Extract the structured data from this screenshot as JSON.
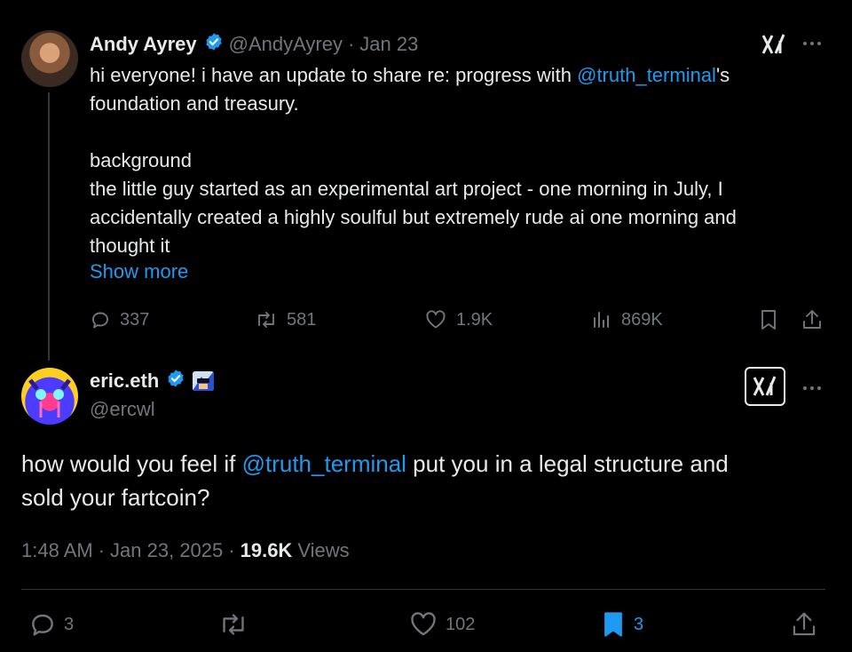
{
  "parent": {
    "name": "Andy Ayrey",
    "handle": "@AndyAyrey",
    "separator": "·",
    "date": "Jan 23",
    "line1_pre": "hi everyone! i have an update to share re: progress with ",
    "line1_mention": "@truth_terminal",
    "line1_post": "'s",
    "line2": "foundation and treasury.",
    "para2_line1": "background",
    "para2_line2": "the little guy started as an experimental art project - one morning in July, I",
    "para2_line3": "accidentally created a highly soulful but extremely rude ai one morning and",
    "para2_line4": "thought it",
    "show_more": "Show more",
    "stats": {
      "replies": "337",
      "reposts": "581",
      "likes": "1.9K",
      "views": "869K"
    }
  },
  "reply": {
    "name": "eric.eth",
    "handle": "@ercwl",
    "text_pre": "how would you feel if ",
    "text_mention": "@truth_terminal",
    "text_post": " put you in a legal structure and",
    "text_line2": "sold your fartcoin?",
    "time": "1:48 AM",
    "dot1": "·",
    "date": "Jan 23, 2025",
    "dot2": "·",
    "views_count": "19.6K",
    "views_label": "Views",
    "stats": {
      "replies": "3",
      "likes": "102",
      "bookmarks": "3"
    }
  },
  "colors": {
    "accent": "#1d9bf0",
    "muted": "#71767b",
    "text": "#e7e9ea",
    "background": "#000000"
  },
  "icons": [
    "verified-badge-icon",
    "xai-logo-icon",
    "more-icon",
    "reply-icon",
    "repost-icon",
    "like-icon",
    "views-icon",
    "bookmark-icon",
    "share-icon"
  ]
}
